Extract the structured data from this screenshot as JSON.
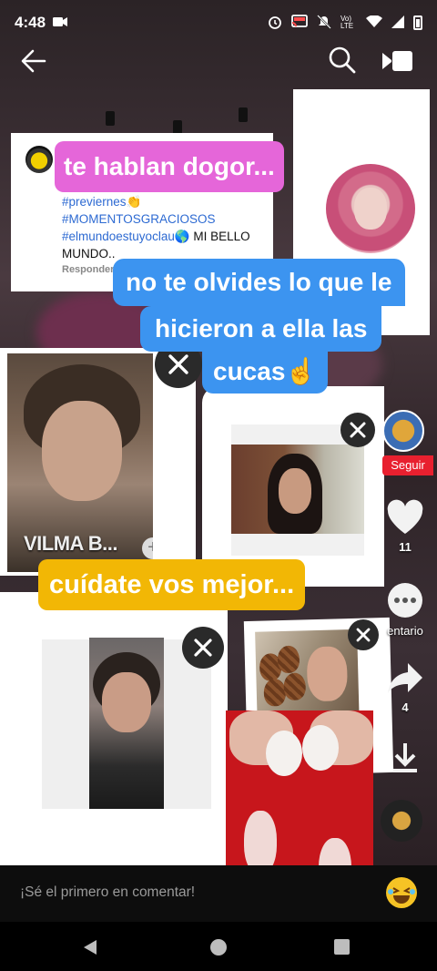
{
  "status_bar": {
    "time": "4:48",
    "network_label": "Vo) LTE"
  },
  "top_bar": {
    "back_icon": "arrow-left-icon",
    "search_icon": "search-icon",
    "camera_icon": "video-camera-icon"
  },
  "comment_card": {
    "tags": [
      "#previernes👏",
      "#MOMENTOSGRACIOSOS"
    ],
    "tag_line3": "#elmundoestuyoclau🌎",
    "tag_line3_rest": " MI BELLO",
    "tag_line4": "MUNDO..",
    "reply_label": "Responder"
  },
  "captions": {
    "pink": "te hablan dogor...",
    "blue_line1": "no te olvides lo que le",
    "blue_line2": "hicieron a ella las",
    "blue_line3": "cucas☝️",
    "yellow": "cuídate vos mejor..."
  },
  "vilma_card": {
    "name_label": "VILMA B...",
    "plus_label": "+"
  },
  "rail": {
    "follow_label": "Seguir",
    "likes_count": "11",
    "comments_label": "entario",
    "shares_count": "4"
  },
  "comment_bar": {
    "placeholder": "¡Sé el primero en comentar!",
    "emoji_icon": "laughing-emoji-icon"
  },
  "nav_bar": {
    "back_icon": "nav-back-icon",
    "home_icon": "nav-home-icon",
    "recents_icon": "nav-recents-icon"
  },
  "colors": {
    "pink_caption": "#e566d9",
    "blue_caption": "#3c94f0",
    "yellow_caption": "#f2b705",
    "follow_red": "#e8202f",
    "hashtag_blue": "#2d6ad2"
  }
}
